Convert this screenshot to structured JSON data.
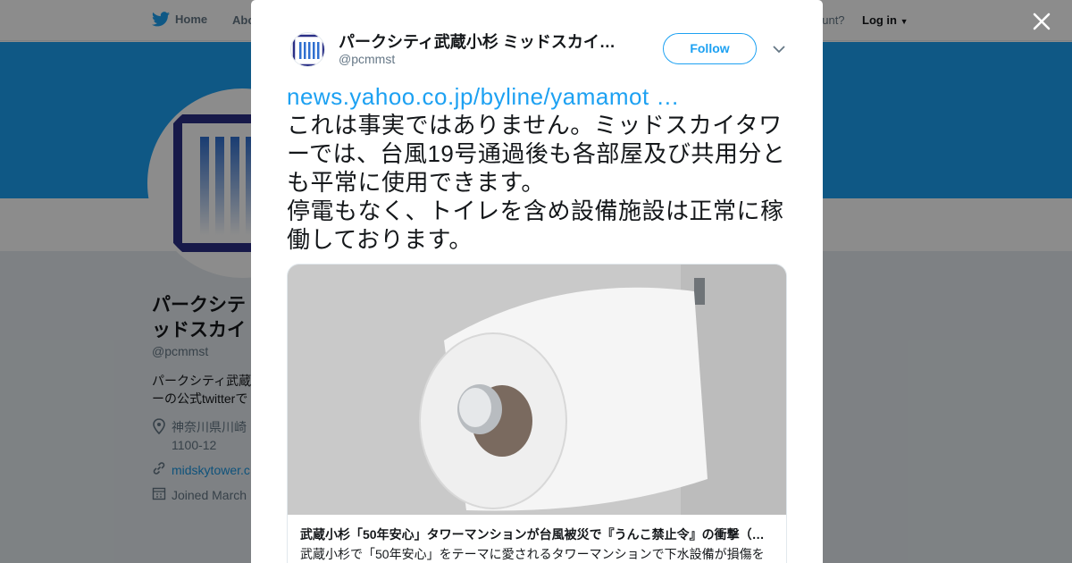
{
  "nav": {
    "home": "Home",
    "about": "Abo",
    "account_prompt": "ccount?",
    "login": "Log in"
  },
  "profile": {
    "name": "パークシテ ィミッドスカイ",
    "name_line1": "パークシテ",
    "name_line2": "ッドスカイ",
    "handle": "@pcmmst",
    "bio_line1": "パークシティ武蔵",
    "bio_line2": "ーの公式twitterで",
    "location_line1": "神奈川県川崎",
    "location_line2": "1100-12",
    "url": "midskytower.c",
    "joined": "Joined March"
  },
  "tweet": {
    "author_name": "パークシティ武蔵小杉 ミッドスカイ…",
    "author_handle": "@pcmmst",
    "follow_label": "Follow",
    "link_text": "news.yahoo.co.jp/byline/yamamot …",
    "body": "これは事実ではありません。ミッドスカイタワーでは、台風19号通過後も各部屋及び共用分とも平常に使用できます。\n停電もなく、トイレを含め設備施設は正常に稼働しております。"
  },
  "card": {
    "title": "武蔵小杉「50年安心」タワーマンションが台風被災で『うんこ禁止令』の衝撃（…",
    "description": "武蔵小杉で「50年安心」をテーマに愛されるタワーマンションで下水設備が損傷を"
  },
  "colors": {
    "twitter_blue": "#1da1f2",
    "link_blue": "#1b95e0",
    "text_dark": "#14171a",
    "text_gray": "#657786"
  },
  "icons": {
    "logo": "bird-icon",
    "close": "close-icon",
    "caret": "chevron-down-icon",
    "location": "location-pin-icon",
    "link": "link-icon",
    "calendar": "calendar-icon"
  }
}
